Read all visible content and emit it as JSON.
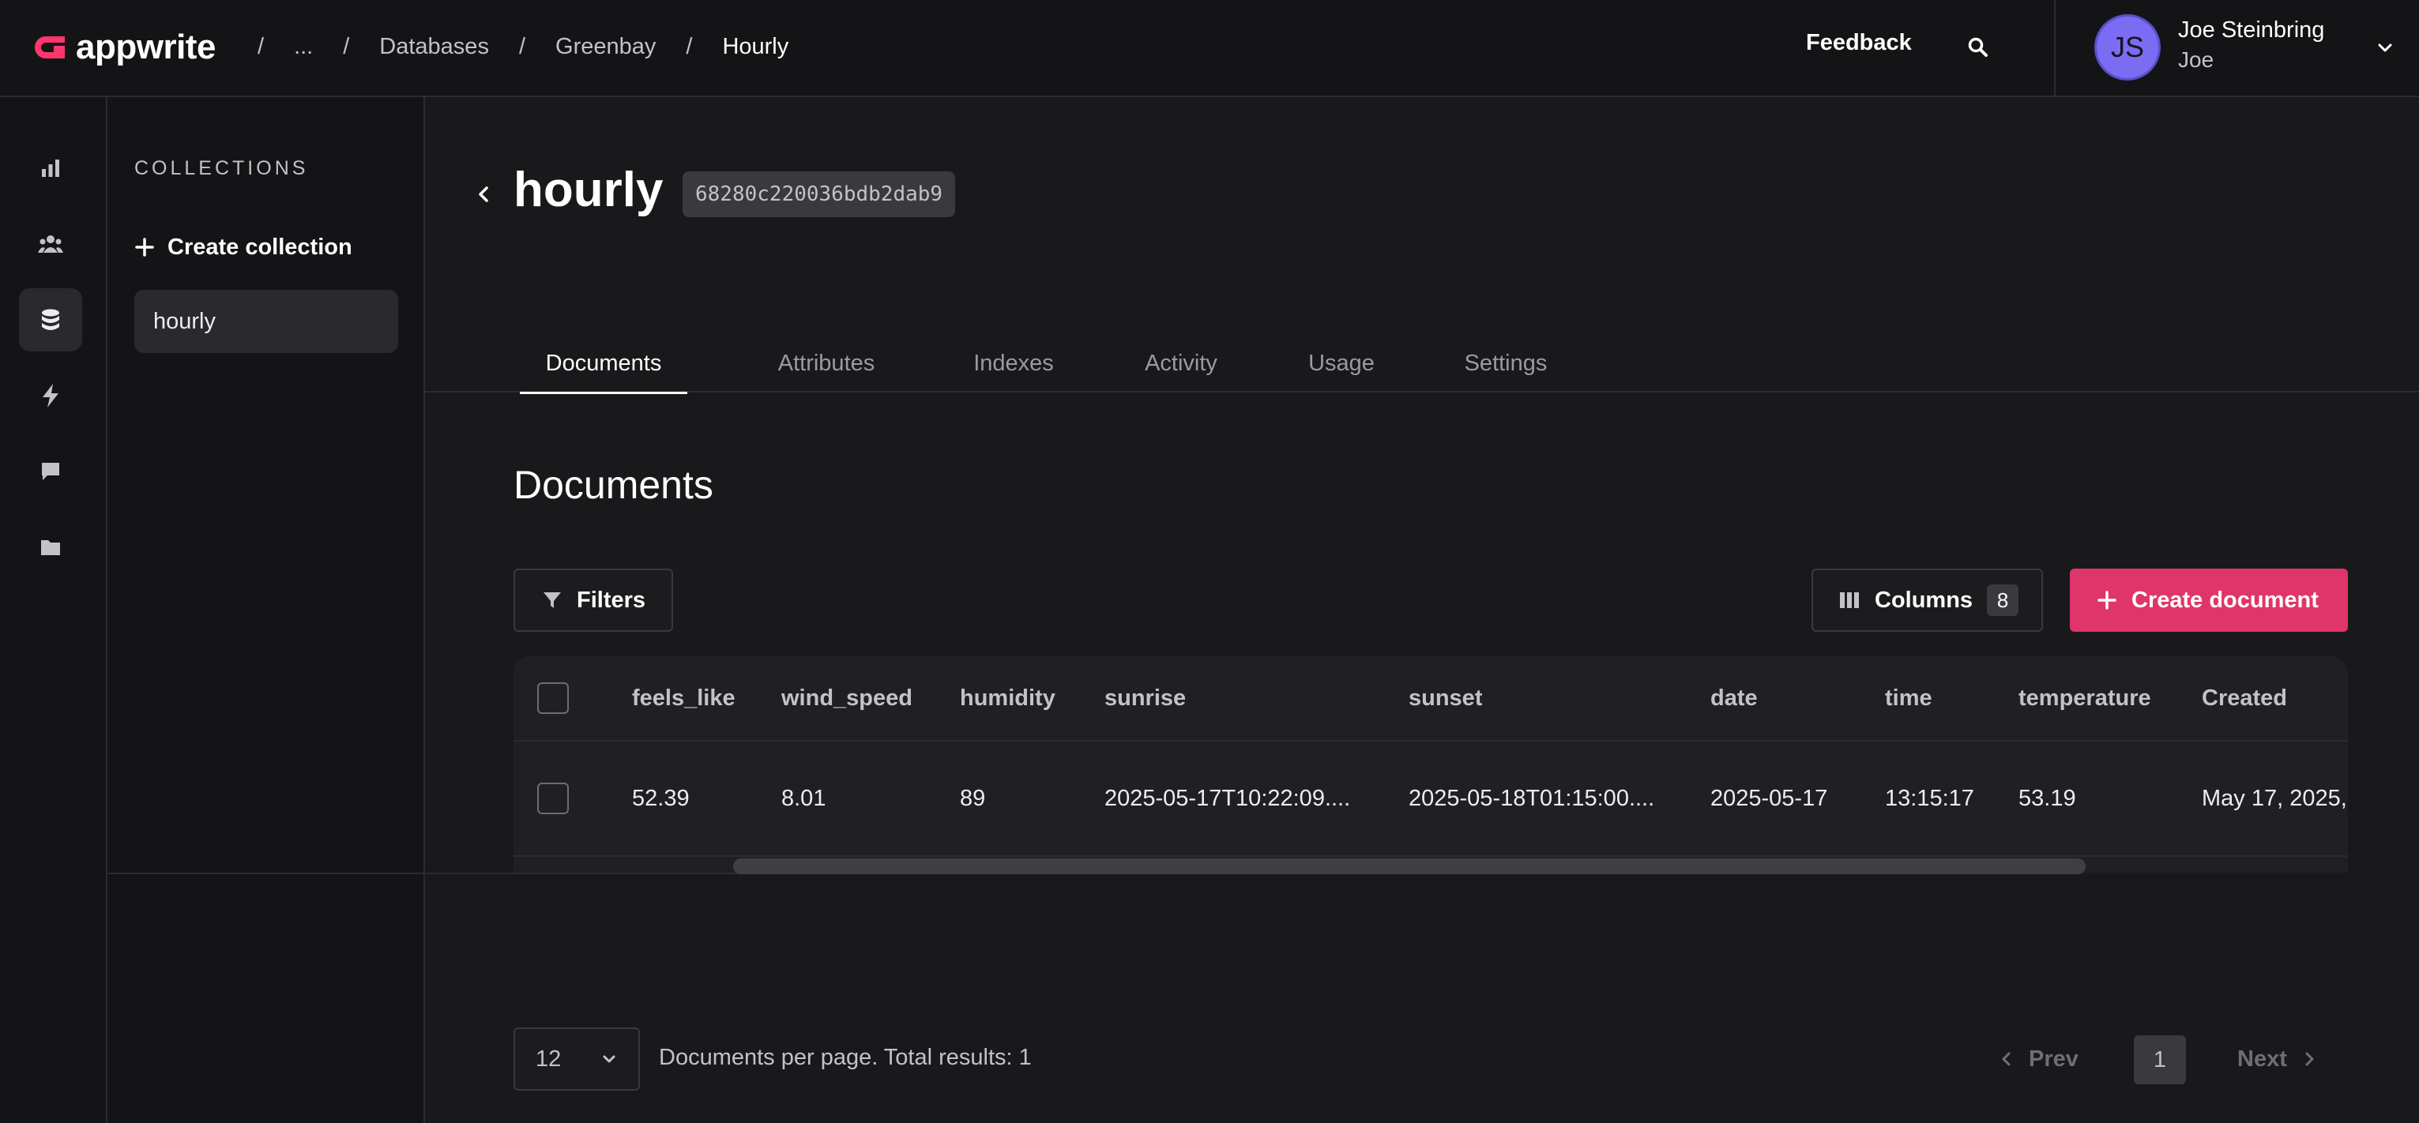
{
  "app": {
    "name": "appwrite"
  },
  "breadcrumbs": [
    {
      "label": "..."
    },
    {
      "label": "Databases"
    },
    {
      "label": "Greenbay"
    },
    {
      "label": "Hourly"
    }
  ],
  "header": {
    "feedback_label": "Feedback",
    "user": {
      "initials": "JS",
      "name": "Joe Steinbring",
      "subtitle": "Joe"
    }
  },
  "rail": {
    "items": [
      {
        "icon": "bar-chart-icon"
      },
      {
        "icon": "users-icon"
      },
      {
        "icon": "database-icon",
        "active": true
      },
      {
        "icon": "lightning-icon"
      },
      {
        "icon": "chat-icon"
      },
      {
        "icon": "folder-icon"
      }
    ]
  },
  "collections": {
    "title": "COLLECTIONS",
    "create_label": "Create collection",
    "items": [
      {
        "label": "hourly",
        "active": true
      }
    ]
  },
  "collection": {
    "title": "hourly",
    "id": "68280c220036bdb2dab9"
  },
  "tabs": [
    {
      "label": "Documents",
      "active": true
    },
    {
      "label": "Attributes"
    },
    {
      "label": "Indexes"
    },
    {
      "label": "Activity"
    },
    {
      "label": "Usage"
    },
    {
      "label": "Settings"
    }
  ],
  "documents": {
    "title": "Documents",
    "filters_label": "Filters",
    "columns_label": "Columns",
    "columns_count": "8",
    "create_label": "Create document",
    "table": {
      "headers": [
        "feels_like",
        "wind_speed",
        "humidity",
        "sunrise",
        "sunset",
        "date",
        "time",
        "temperature",
        "Created"
      ],
      "rows": [
        [
          "52.39",
          "8.01",
          "89",
          "2025-05-17T10:22:09....",
          "2025-05-18T01:15:00....",
          "2025-05-17",
          "13:15:17",
          "53.19",
          "May 17, 2025,"
        ]
      ]
    },
    "per_page_value": "12",
    "per_page_text": "Documents per page. Total results: 1",
    "pagination": {
      "prev_label": "Prev",
      "current_page": "1",
      "next_label": "Next"
    }
  },
  "colors": {
    "accent": "#e0356a",
    "avatar": "#7c6cf2",
    "background": "#19191c"
  }
}
